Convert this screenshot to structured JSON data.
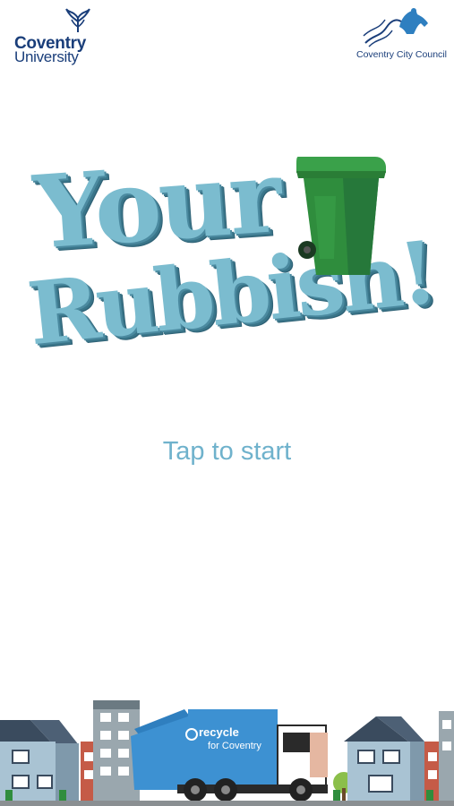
{
  "logos": {
    "university_line1": "Coventry",
    "university_line2": "University",
    "council": "Coventry City Council"
  },
  "title": {
    "line1": "Your",
    "line2": "Rubbish!"
  },
  "start_prompt": "Tap to start",
  "truck": {
    "brand_line1": "recycle",
    "brand_line2": "for Coventry"
  },
  "colors": {
    "title_fill": "#7bbccf",
    "title_shadow": "#3a7589",
    "prompt": "#6fb2cc",
    "bin": "#2f8d3d",
    "truck": "#3d91d2",
    "logo": "#1a3e7a"
  }
}
